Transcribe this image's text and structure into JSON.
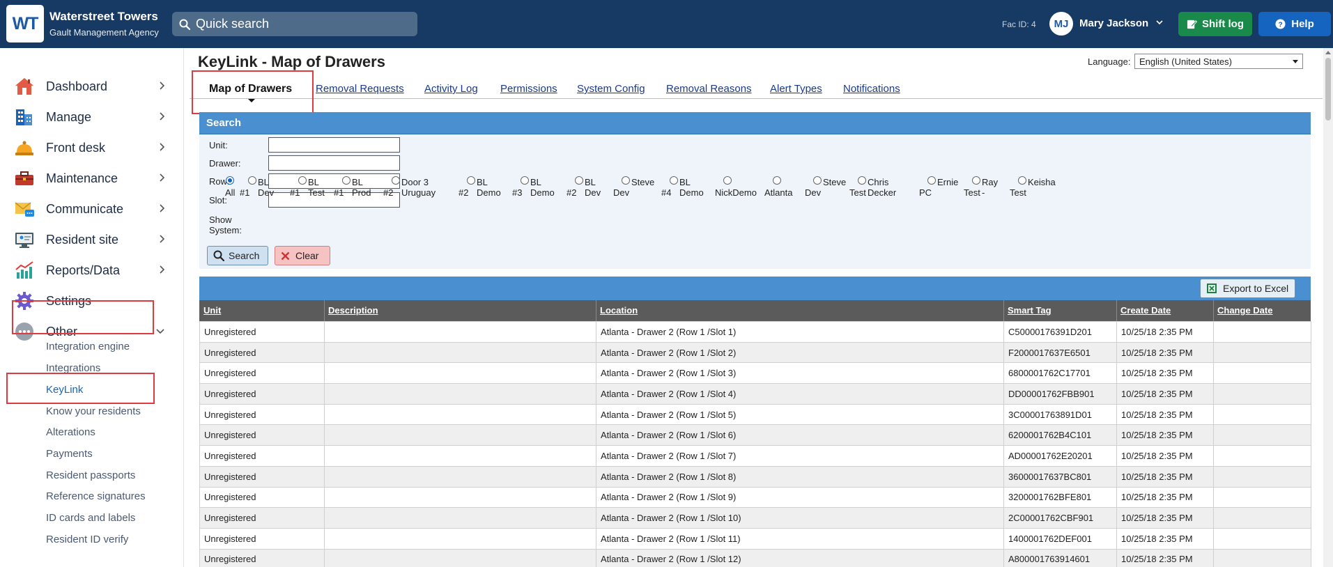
{
  "brand": {
    "logo": "WT",
    "name": "Waterstreet Towers",
    "sub": "Gault Management Agency"
  },
  "header": {
    "search_placeholder": "Quick search",
    "fac_id": "Fac ID: 4",
    "user_initials": "MJ",
    "user_name": "Mary Jackson",
    "shift_log": "Shift log",
    "help": "Help"
  },
  "sidebar": {
    "items": [
      {
        "label": "Dashboard"
      },
      {
        "label": "Manage"
      },
      {
        "label": "Front desk"
      },
      {
        "label": "Maintenance"
      },
      {
        "label": "Communicate"
      },
      {
        "label": "Resident site"
      },
      {
        "label": "Reports/Data"
      },
      {
        "label": "Settings"
      },
      {
        "label": "Other"
      }
    ],
    "sub_items": [
      "Integration engine",
      "Integrations",
      "KeyLink",
      "Know your residents",
      "Alterations",
      "Payments",
      "Resident passports",
      "Reference signatures",
      "ID cards and labels",
      "Resident ID verify"
    ]
  },
  "main": {
    "title": "KeyLink - Map of Drawers",
    "language_label": "Language:",
    "language_value": "English (United States)",
    "tabs": [
      "Map of Drawers",
      "Removal Requests",
      "Activity Log",
      "Permissions",
      "System Config",
      "Removal Reasons",
      "Alert Types",
      "Notifications"
    ]
  },
  "search": {
    "header": "Search",
    "fields": {
      "unit": "Unit:",
      "drawer": "Drawer:",
      "row": "Row:",
      "slot": "Slot:"
    },
    "show_system_label": [
      "Show",
      "System:"
    ],
    "systems": [
      [
        "",
        "All"
      ],
      [
        "BL Dev",
        "#1"
      ],
      [
        "BL Test",
        "#1"
      ],
      [
        "BL Prod",
        "#1"
      ],
      [
        "Door 3 Uruguay",
        "#2"
      ],
      [
        "BL Demo",
        "#2"
      ],
      [
        "BL Demo",
        "#3"
      ],
      [
        "BL Dev",
        "#2"
      ],
      [
        "Steve",
        "Dev"
      ],
      [
        "BL Demo",
        "#4"
      ],
      [
        "",
        "NickDemo"
      ],
      [
        "",
        "Atlanta"
      ],
      [
        "Steve",
        "Dev"
      ],
      [
        "Chris Decker",
        "Test"
      ],
      [
        "Ernie",
        "PC"
      ],
      [
        "Ray -",
        "Test"
      ],
      [
        "Keisha",
        "Test"
      ]
    ],
    "search_button": "Search",
    "clear_button": "Clear"
  },
  "results": {
    "export_button": "Export to Excel",
    "columns": [
      "Unit",
      "Description",
      "Location",
      "Smart Tag",
      "Create Date",
      "Change Date"
    ],
    "rows": [
      [
        "Unregistered",
        "",
        "Atlanta - Drawer 2 (Row 1 /Slot 1)",
        "C50000176391D201",
        "10/25/18 2:35 PM",
        ""
      ],
      [
        "Unregistered",
        "",
        "Atlanta - Drawer 2 (Row 1 /Slot 2)",
        "F2000017637E6501",
        "10/25/18 2:35 PM",
        ""
      ],
      [
        "Unregistered",
        "",
        "Atlanta - Drawer 2 (Row 1 /Slot 3)",
        "6800001762C17701",
        "10/25/18 2:35 PM",
        ""
      ],
      [
        "Unregistered",
        "",
        "Atlanta - Drawer 2 (Row 1 /Slot 4)",
        "DD00001762FBB901",
        "10/25/18 2:35 PM",
        ""
      ],
      [
        "Unregistered",
        "",
        "Atlanta - Drawer 2 (Row 1 /Slot 5)",
        "3C00001763891D01",
        "10/25/18 2:35 PM",
        ""
      ],
      [
        "Unregistered",
        "",
        "Atlanta - Drawer 2 (Row 1 /Slot 6)",
        "6200001762B4C101",
        "10/25/18 2:35 PM",
        ""
      ],
      [
        "Unregistered",
        "",
        "Atlanta - Drawer 2 (Row 1 /Slot 7)",
        "AD00001762E20201",
        "10/25/18 2:35 PM",
        ""
      ],
      [
        "Unregistered",
        "",
        "Atlanta - Drawer 2 (Row 1 /Slot 8)",
        "36000017637BC801",
        "10/25/18 2:35 PM",
        ""
      ],
      [
        "Unregistered",
        "",
        "Atlanta - Drawer 2 (Row 1 /Slot 9)",
        "3200001762BFE801",
        "10/25/18 2:35 PM",
        ""
      ],
      [
        "Unregistered",
        "",
        "Atlanta - Drawer 2 (Row 1 /Slot 10)",
        "2C00001762CBF901",
        "10/25/18 2:35 PM",
        ""
      ],
      [
        "Unregistered",
        "",
        "Atlanta - Drawer 2 (Row 1 /Slot 11)",
        "1400001762DEF001",
        "10/25/18 2:35 PM",
        ""
      ],
      [
        "Unregistered",
        "",
        "Atlanta - Drawer 2 (Row 1 /Slot 12)",
        "A800001763914601",
        "10/25/18 2:35 PM",
        ""
      ]
    ]
  },
  "colors": {
    "topbar": "#163a63",
    "accent_blue": "#4a90d0",
    "shift_green": "#1a8a4a",
    "help_blue": "#1565c0",
    "highlight_red": "#e0393e"
  },
  "icons": {
    "dashboard": "house-icon",
    "manage": "buildings-icon",
    "front_desk": "bell-icon",
    "maintenance": "toolbox-icon",
    "communicate": "envelope-icon",
    "resident_site": "monitor-icon",
    "reports": "bar-chart-icon",
    "settings": "gear-icon",
    "other": "more-dots-icon"
  }
}
